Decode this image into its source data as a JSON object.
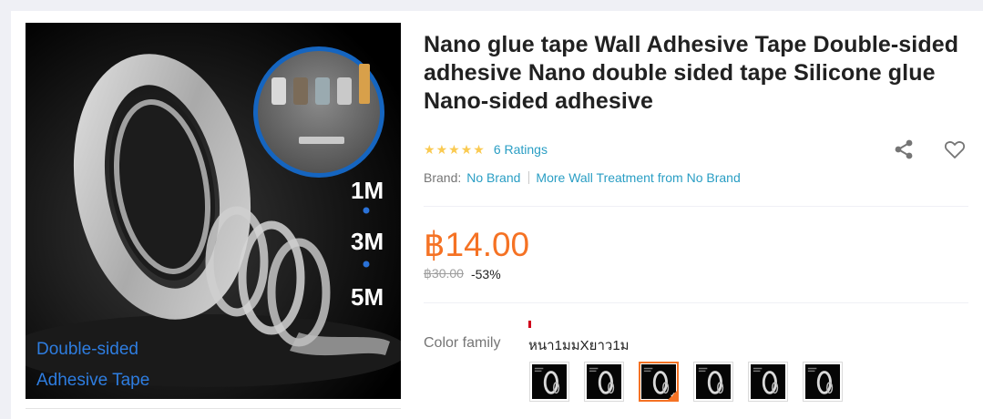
{
  "gallery": {
    "lengths": [
      "1M",
      "3M",
      "5M"
    ],
    "caption_line1": "Double-sided",
    "caption_line2": "Adhesive Tape"
  },
  "product": {
    "title": "Nano glue tape Wall Adhesive Tape Double-sided adhesive Nano double sided tape Silicone glue Nano-sided adhesive",
    "rating_stars": 5,
    "ratings_text": "6 Ratings",
    "brand_label": "Brand:",
    "brand_name": "No Brand",
    "more_link": "More Wall Treatment from No Brand",
    "price": "฿14.00",
    "original_price": "฿30.00",
    "discount": "-53%",
    "color_label": "Color family",
    "color_value": "หนา1มมXยาว1ม",
    "selected_swatch_index": 2,
    "swatch_count": 6
  },
  "icons": {
    "share": "share-icon",
    "wishlist": "heart-outline-icon",
    "star": "star-icon"
  },
  "colors": {
    "accent": "#f57224",
    "link": "#2a9ec4",
    "star": "#faca51"
  }
}
